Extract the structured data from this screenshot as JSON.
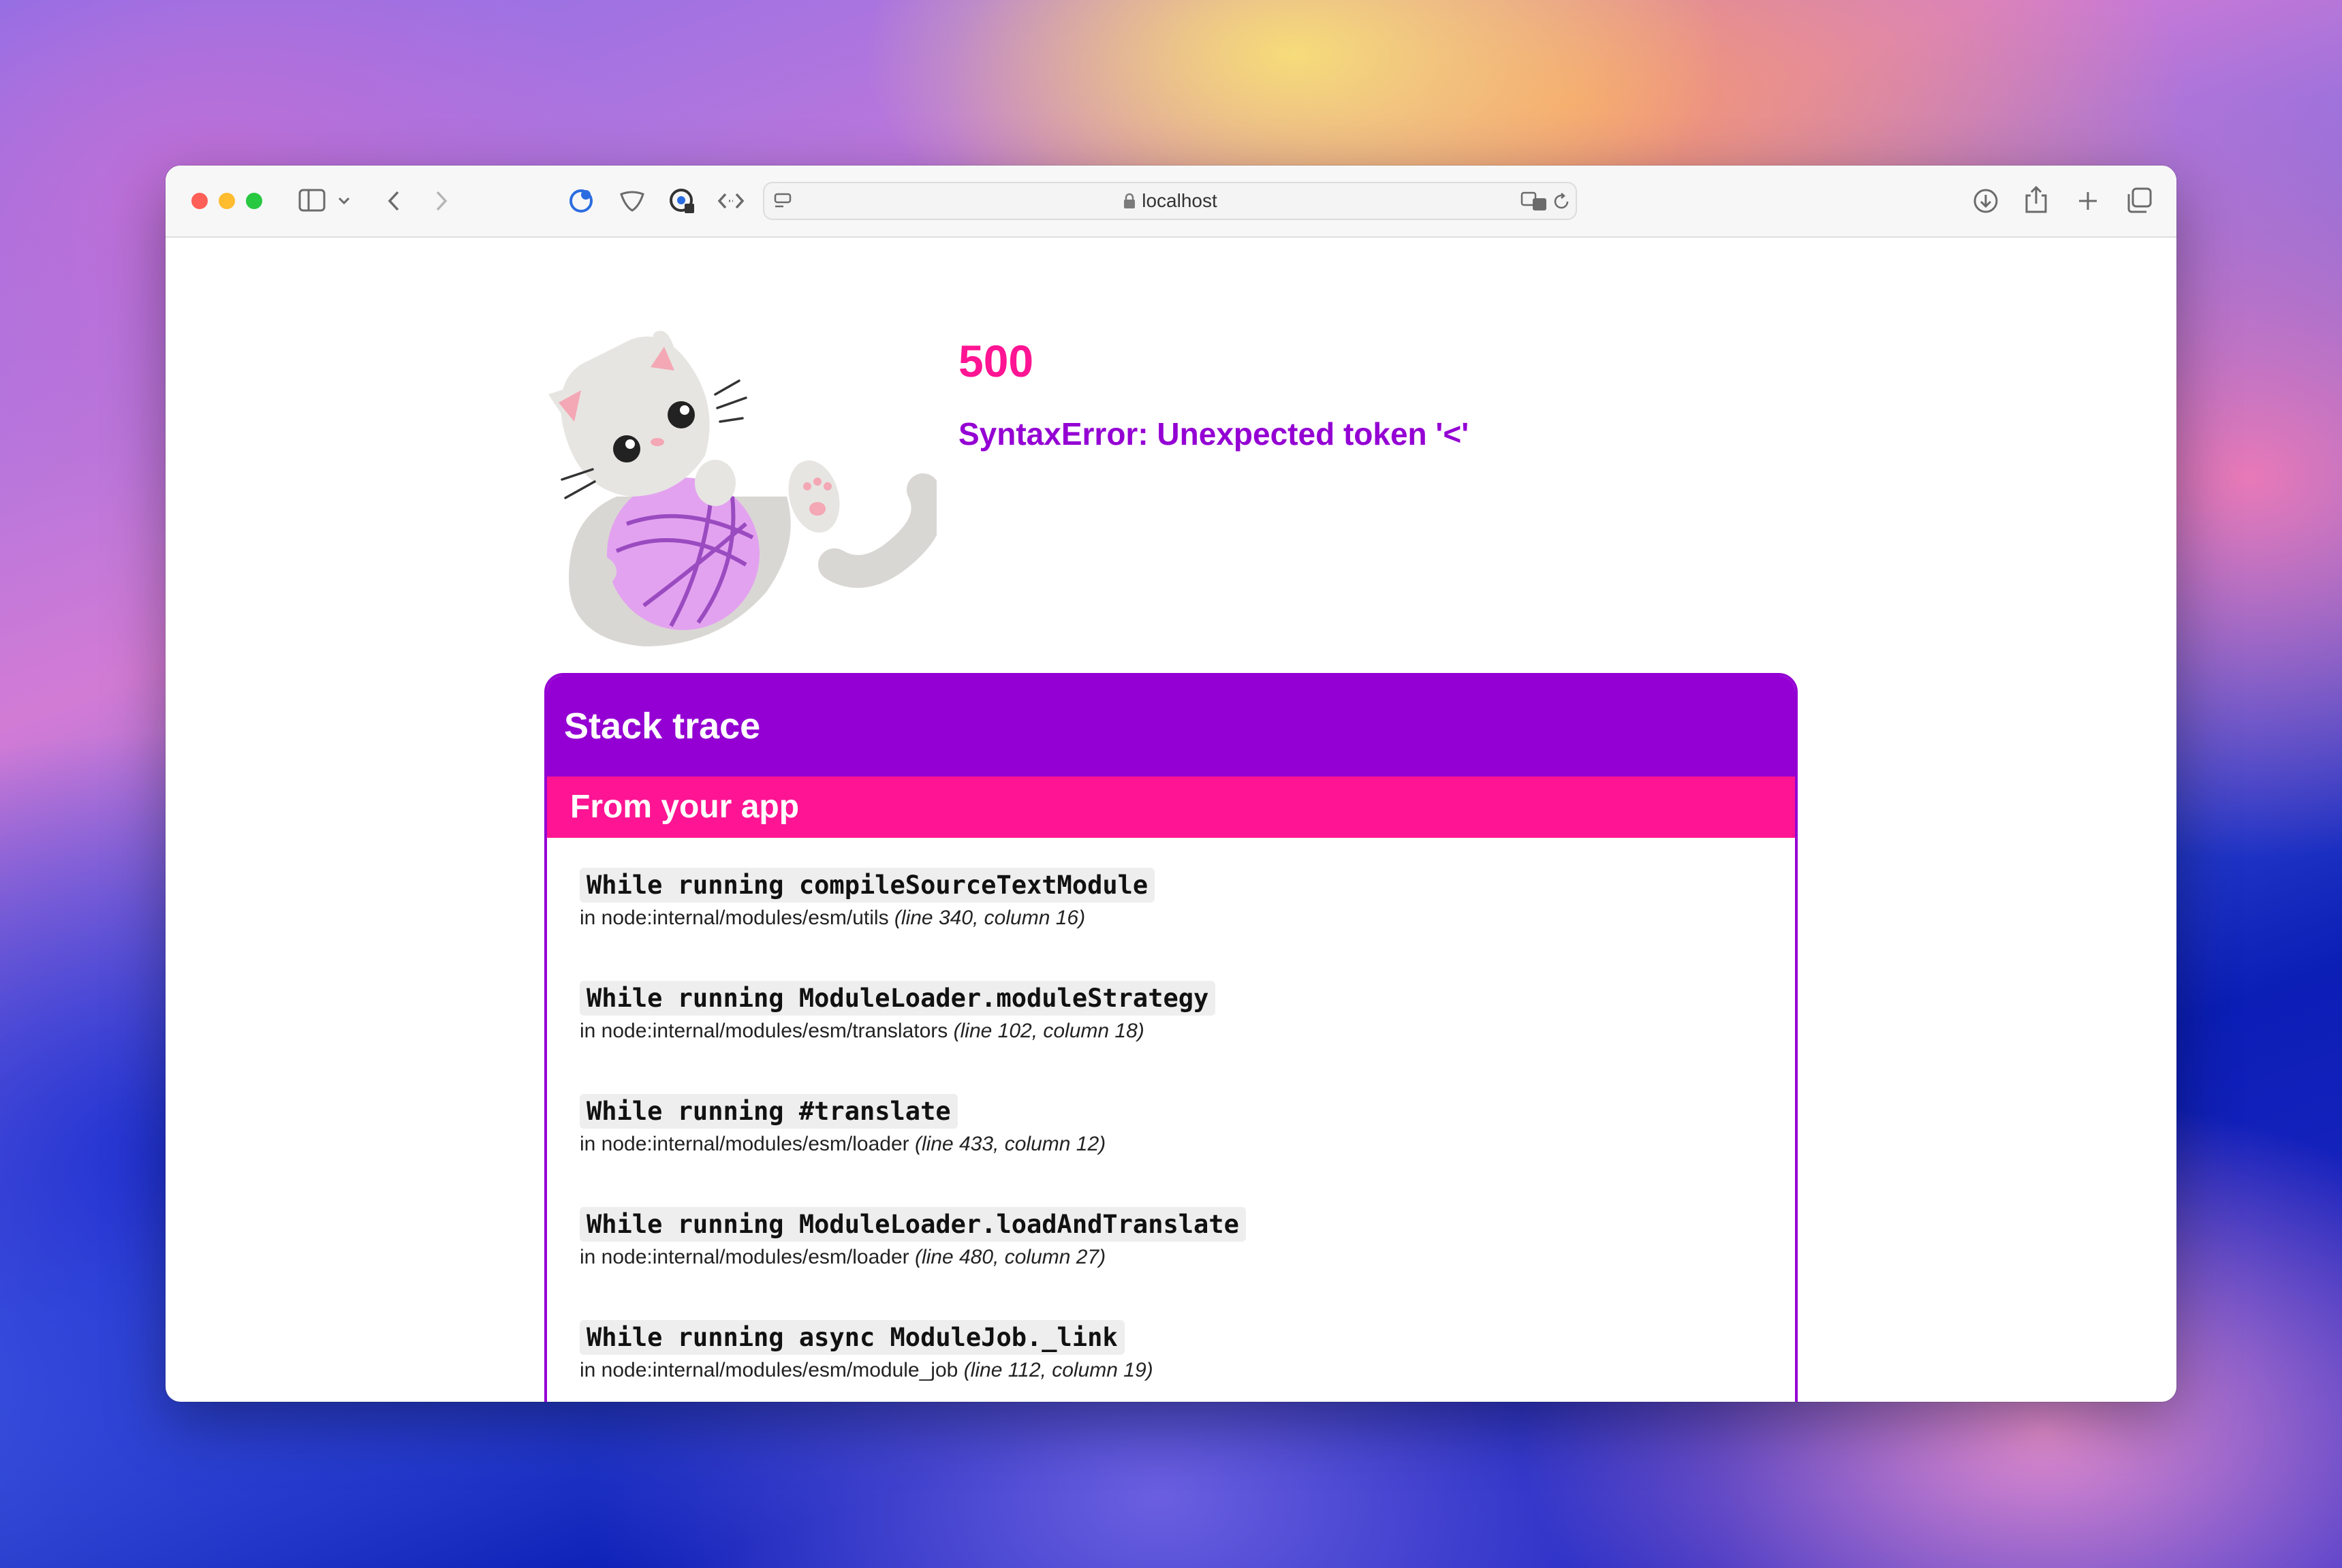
{
  "browser": {
    "address": "localhost",
    "icons": {
      "sidebar": "sidebar-icon",
      "back": "chevron-left-icon",
      "forward": "chevron-right-icon",
      "download": "download-icon",
      "share": "share-icon",
      "new_tab": "plus-icon",
      "tabs": "tab-overview-icon"
    }
  },
  "error": {
    "code": "500",
    "message": "SyntaxError: Unexpected token '<'"
  },
  "stack": {
    "title": "Stack trace",
    "section": "From your app",
    "frames": [
      {
        "name": "While running compileSourceTextModule",
        "file": "in node:internal/modules/esm/utils",
        "pos": "(line 340, column 16)"
      },
      {
        "name": "While running ModuleLoader.moduleStrategy",
        "file": "in node:internal/modules/esm/translators",
        "pos": "(line 102, column 18)"
      },
      {
        "name": "While running #translate",
        "file": "in node:internal/modules/esm/loader",
        "pos": "(line 433, column 12)"
      },
      {
        "name": "While running ModuleLoader.loadAndTranslate",
        "file": "in node:internal/modules/esm/loader",
        "pos": "(line 480, column 27)"
      },
      {
        "name": "While running async ModuleJob._link",
        "file": "in node:internal/modules/esm/module_job",
        "pos": "(line 112, column 19)"
      }
    ]
  },
  "colors": {
    "accent_pink": "#ff1493",
    "accent_purple": "#9400d3"
  }
}
